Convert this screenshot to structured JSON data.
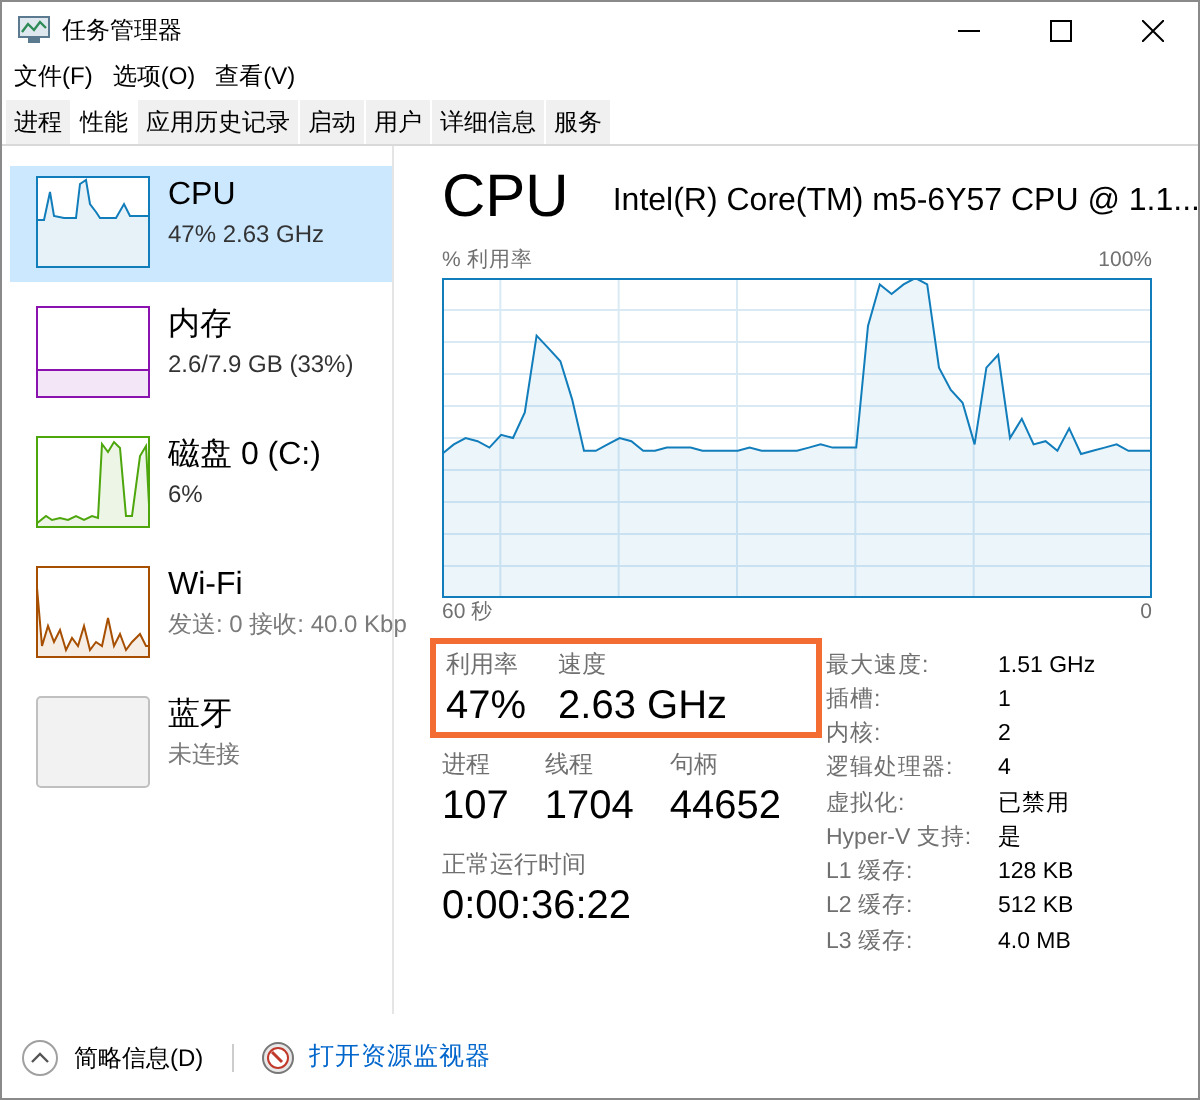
{
  "window": {
    "title": "任务管理器"
  },
  "menu": [
    "文件(F)",
    "选项(O)",
    "查看(V)"
  ],
  "tabs": [
    {
      "label": "进程",
      "selected": false
    },
    {
      "label": "性能",
      "selected": true
    },
    {
      "label": "应用历史记录",
      "selected": false
    },
    {
      "label": "启动",
      "selected": false
    },
    {
      "label": "用户",
      "selected": false
    },
    {
      "label": "详细信息",
      "selected": false
    },
    {
      "label": "服务",
      "selected": false
    }
  ],
  "sidebar": {
    "items": [
      {
        "kind": "graph",
        "title": "CPU",
        "detail": "47% 2.63 GHz",
        "color": "#117dbb",
        "selected": true,
        "dimmed": false
      },
      {
        "kind": "graph",
        "title": "内存",
        "detail": "2.6/7.9 GB (33%)",
        "color": "#8b12ae",
        "selected": false,
        "dimmed": false
      },
      {
        "kind": "graph",
        "title": "磁盘 0 (C:)",
        "detail": "6%",
        "color": "#4da60c",
        "selected": false,
        "dimmed": false
      },
      {
        "kind": "graph",
        "title": "Wi-Fi",
        "detail": "发送: 0 接收: 40.0 Kbp",
        "color": "#a74f01",
        "selected": false,
        "dimmed": true
      },
      {
        "kind": "empty",
        "title": "蓝牙",
        "detail": "未连接",
        "color": "#c0c0c0",
        "selected": false,
        "dimmed": true
      }
    ]
  },
  "main": {
    "title": "CPU",
    "model": "Intel(R) Core(TM) m5-6Y57 CPU @ 1.1...",
    "graph": {
      "axis_label": "% 利用率",
      "max_label": "100%",
      "time_label": "60 秒",
      "end_label": "0"
    },
    "highlight_stats": [
      {
        "label": "利用率",
        "value": "47%"
      },
      {
        "label": "速度",
        "value": "2.63 GHz"
      }
    ],
    "stats": [
      {
        "label": "进程",
        "value": "107"
      },
      {
        "label": "线程",
        "value": "1704"
      },
      {
        "label": "句柄",
        "value": "44652"
      }
    ],
    "uptime": {
      "label": "正常运行时间",
      "value": "0:00:36:22"
    },
    "details": [
      {
        "label": "最大速度:",
        "value": "1.51 GHz"
      },
      {
        "label": "插槽:",
        "value": "1"
      },
      {
        "label": "内核:",
        "value": "2"
      },
      {
        "label": "逻辑处理器:",
        "value": "4"
      },
      {
        "label": "虚拟化:",
        "value": "已禁用"
      },
      {
        "label": "Hyper-V 支持:",
        "value": "是"
      },
      {
        "label": "L1 缓存:",
        "value": "128 KB"
      },
      {
        "label": "L2 缓存:",
        "value": "512 KB"
      },
      {
        "label": "L3 缓存:",
        "value": "4.0 MB"
      }
    ]
  },
  "footer": {
    "summary": "简略信息(D)",
    "link": "打开资源监视器"
  }
}
